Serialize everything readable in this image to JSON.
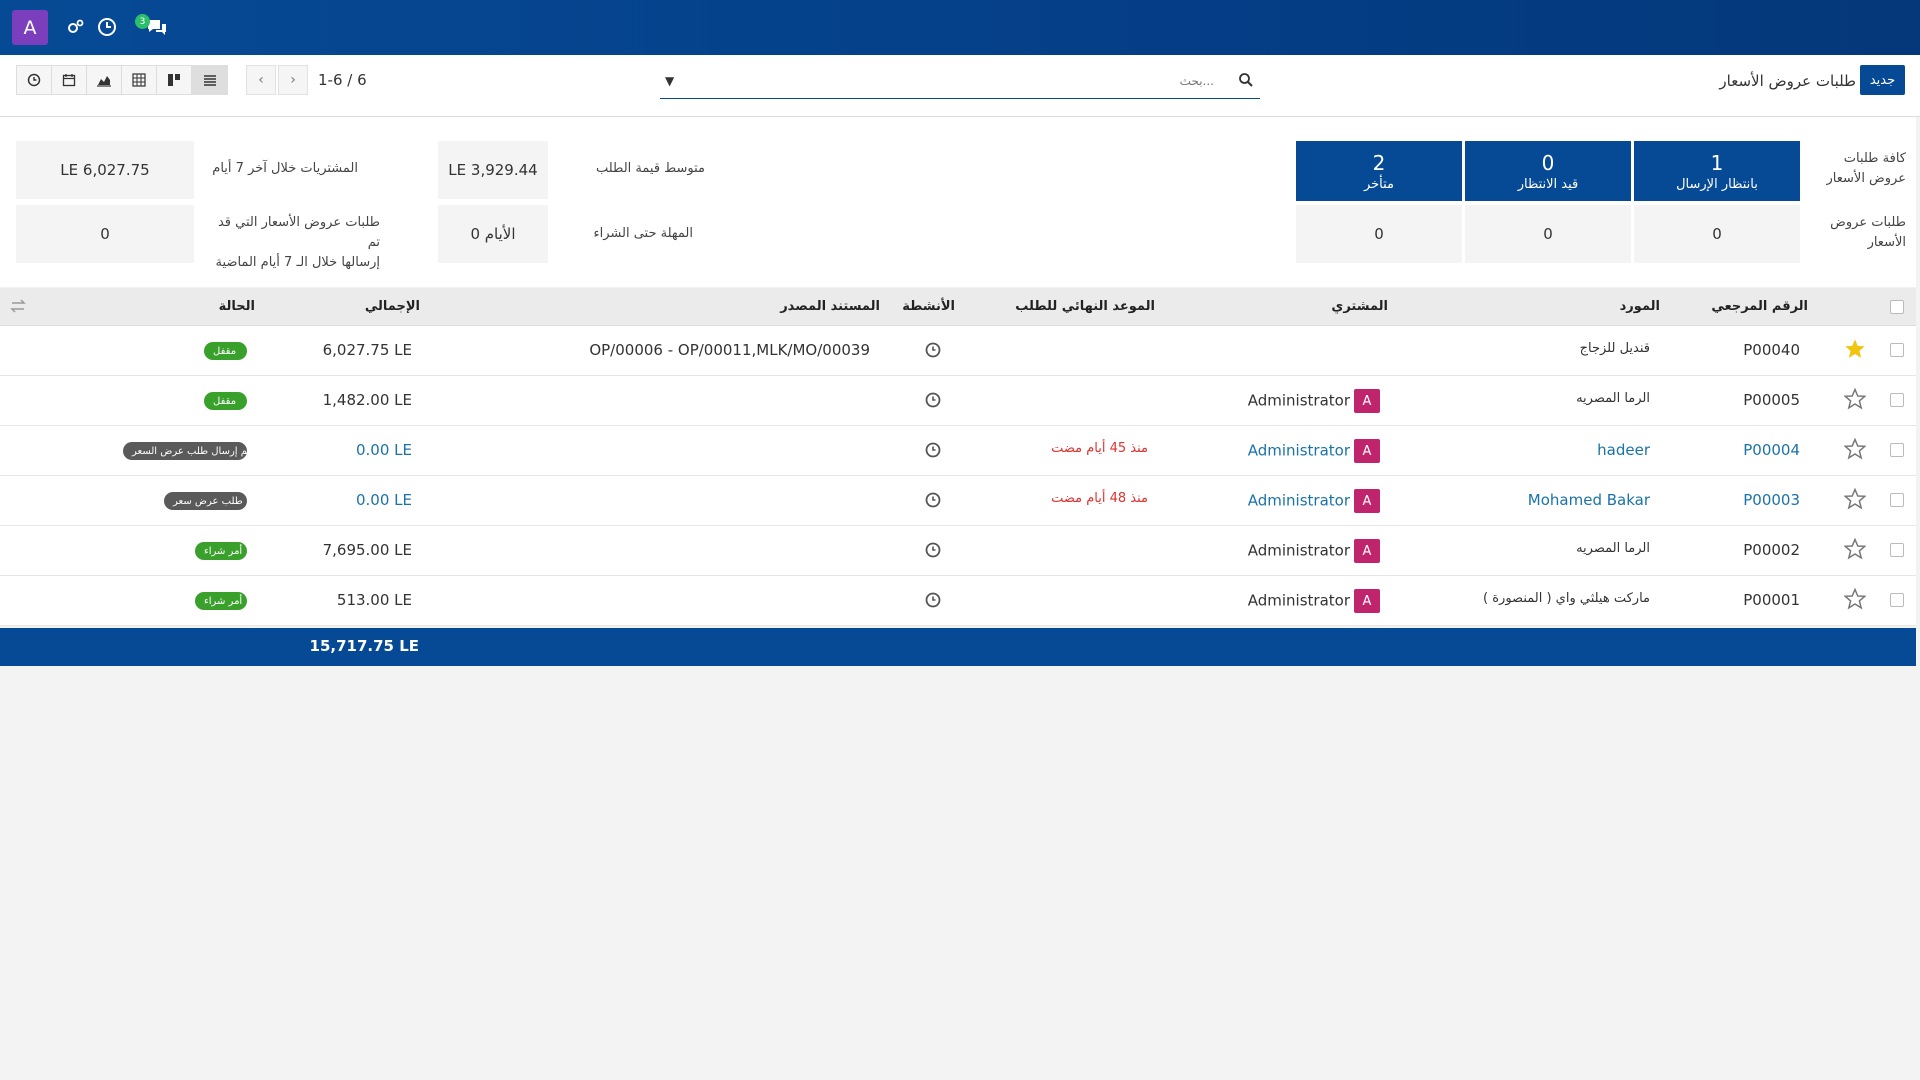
{
  "navbar": {
    "avatar_letter": "A",
    "badge_count": "3",
    "icons": [
      "settings-icon",
      "clock-icon",
      "chat-icon"
    ]
  },
  "control_panel": {
    "new_button": "جديد",
    "breadcrumb": "طلبات عروض الأسعار",
    "search_placeholder": "بحث...",
    "pager_text": "1-6 / 6",
    "view_icons": [
      "list-icon",
      "kanban-icon",
      "pivot-icon",
      "graph-icon",
      "calendar-icon",
      "activity-icon"
    ]
  },
  "dashboard": {
    "all_rfq_label": "كافة طلبات عروض الأسعار",
    "my_rfq_label": "طلبات عروض الأسعار",
    "stat_boxes": [
      {
        "value": "1",
        "label": "بانتظار الإرسال"
      },
      {
        "value": "0",
        "label": "قيد الانتظار"
      },
      {
        "value": "2",
        "label": "متأخر"
      }
    ],
    "stat_cells": [
      "0",
      "0",
      "0"
    ],
    "kpi": {
      "avg_order_label": "متوسط قيمة الطلب",
      "avg_order_value": "LE 3,929.44",
      "purchased_label": "المشتريات خلال آخر 7 أيام",
      "purchased_value": "LE 6,027.75",
      "lead_time_label": "المهلة حتى الشراء",
      "lead_time_value": "0 الأيام",
      "rfq_sent_label_1": "طلبات عروض الأسعار التي قد تم",
      "rfq_sent_label_2": "إرسالها خلال الـ 7 أيام الماضية",
      "rfq_sent_value": "0"
    }
  },
  "table": {
    "headers": {
      "reference": "الرقم المرجعي",
      "vendor": "المورد",
      "buyer": "المشتري",
      "deadline": "الموعد النهائي للطلب",
      "activities": "الأنشطة",
      "source": "المستند المصدر",
      "total": "الإجمالي",
      "status": "الحالة"
    },
    "rows": [
      {
        "ref": "P00040",
        "starred": true,
        "vendor": "قنديل للزجاج",
        "buyer": "",
        "deadline": "",
        "source": "OP/00006 - OP/00011,MLK/MO/00039",
        "total": "6,027.75 LE",
        "status": "مقفل",
        "status_color": "#3aa02c",
        "link": false
      },
      {
        "ref": "P00005",
        "starred": false,
        "vendor": "الرما المصريه",
        "buyer": "Administrator",
        "deadline": "",
        "source": "",
        "total": "1,482.00 LE",
        "status": "مقفل",
        "status_color": "#3aa02c",
        "link": false
      },
      {
        "ref": "P00004",
        "starred": false,
        "vendor": "hadeer",
        "buyer": "Administrator",
        "deadline": "منذ 45 أيام مضت",
        "source": "",
        "total": "0.00 LE",
        "status": "تم إرسال طلب عرض السعر",
        "status_color": "#5a5a5a",
        "link": true
      },
      {
        "ref": "P00003",
        "starred": false,
        "vendor": "Mohamed Bakar",
        "buyer": "Administrator",
        "deadline": "منذ 48 أيام مضت",
        "source": "",
        "total": "0.00 LE",
        "status": "طلب عرض سعر",
        "status_color": "#5a5a5a",
        "link": true
      },
      {
        "ref": "P00002",
        "starred": false,
        "vendor": "الرما المصريه",
        "buyer": "Administrator",
        "deadline": "",
        "source": "",
        "total": "7,695.00 LE",
        "status": "أمر شراء",
        "status_color": "#3aa02c",
        "link": false
      },
      {
        "ref": "P00001",
        "starred": false,
        "vendor": "ماركت هيلثي واي ( المنصورة )",
        "buyer": "Administrator",
        "deadline": "",
        "source": "",
        "total": "513.00 LE",
        "status": "أمر شراء",
        "status_color": "#3aa02c",
        "link": false
      }
    ],
    "footer_total": "15,717.75 LE",
    "avatar_letter": "A"
  }
}
